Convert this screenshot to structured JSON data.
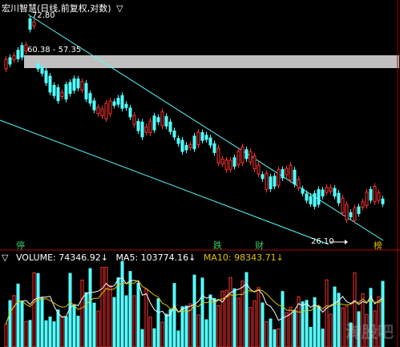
{
  "header": {
    "title": "宏川智慧(日线,前复权,对数)",
    "menu_icon": "triangle-down-icon"
  },
  "price_axis": {
    "high_label": "72.80",
    "band_label": "60.38 - 57.35",
    "low_label": "26.10"
  },
  "badges": [
    {
      "text": "停",
      "color": "#33cc66"
    },
    {
      "text": "跌",
      "color": "#33cc66"
    },
    {
      "text": "财",
      "color": "#33cc66"
    },
    {
      "text": "榜",
      "color": "#e0c000"
    }
  ],
  "volume_header": {
    "volume": "VOLUME: 74346.92↓",
    "ma5": "MA5: 103774.16↓",
    "ma10": "MA10: 98343.71↓"
  },
  "colors": {
    "up": "#ff3232",
    "down": "#54ffff",
    "band": "#c0c0c0",
    "trendline": "#54ffff",
    "ma5": "#ffffff",
    "ma10": "#e0c000",
    "separator": "#b00000"
  },
  "watermark": "淘股吧"
}
